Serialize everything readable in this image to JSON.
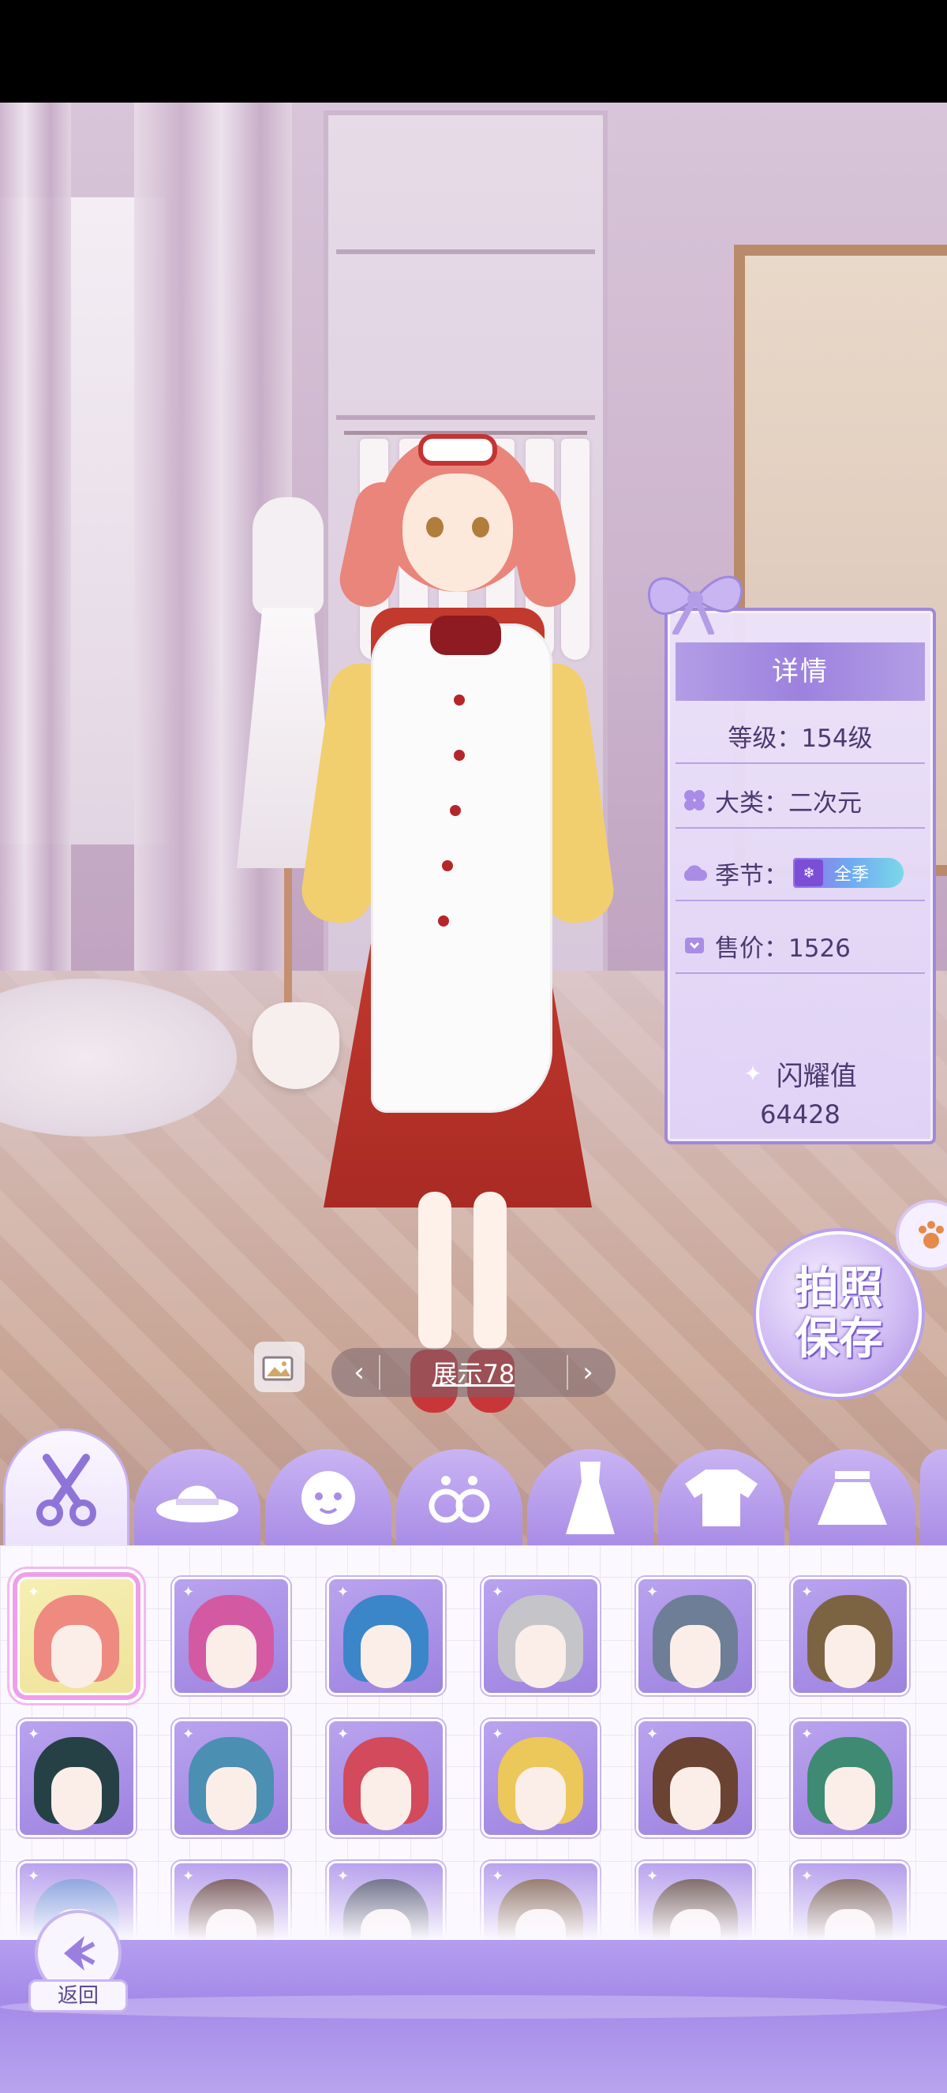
{
  "details": {
    "title": "详情",
    "level": "等级：154级",
    "category": "大类：二次元",
    "season_label": "季节：",
    "season_badge": "全季",
    "price": "售价：1526",
    "shine_label": "闪耀值",
    "shine_value": "64428"
  },
  "photo_save": {
    "line1": "拍照",
    "line2": "保存"
  },
  "showcase": {
    "label": "展示78"
  },
  "tabs": [
    {
      "name": "hairstyle",
      "icon": "scissors-icon",
      "active": true
    },
    {
      "name": "hat",
      "icon": "hat-icon"
    },
    {
      "name": "face",
      "icon": "face-icon"
    },
    {
      "name": "earrings",
      "icon": "earrings-icon"
    },
    {
      "name": "dress",
      "icon": "dress-icon"
    },
    {
      "name": "top",
      "icon": "shirt-icon"
    },
    {
      "name": "skirt",
      "icon": "skirt-icon"
    }
  ],
  "hair_items": [
    {
      "color": "#ee8a80",
      "selected": true
    },
    {
      "color": "#d35aa2"
    },
    {
      "color": "#3b86c9"
    },
    {
      "color": "#c4c4c9"
    },
    {
      "color": "#6d7e96"
    },
    {
      "color": "#7c6442"
    },
    {
      "color": "#254146"
    },
    {
      "color": "#4b8fb2"
    },
    {
      "color": "#d24a5c"
    },
    {
      "color": "#ecc75a"
    },
    {
      "color": "#6a4332"
    },
    {
      "color": "#3f8a72"
    },
    {
      "color": "#6f8fd6"
    },
    {
      "color": "#5e3b3a"
    },
    {
      "color": "#4b4e6b"
    },
    {
      "color": "#7a5a48"
    },
    {
      "color": "#5d4440"
    },
    {
      "color": "#6b5048"
    }
  ],
  "back": {
    "label": "返回"
  },
  "colors": {
    "accent": "#a98ce6",
    "panel": "#fbf9ff",
    "selected_glow": "#ef9fe9"
  }
}
